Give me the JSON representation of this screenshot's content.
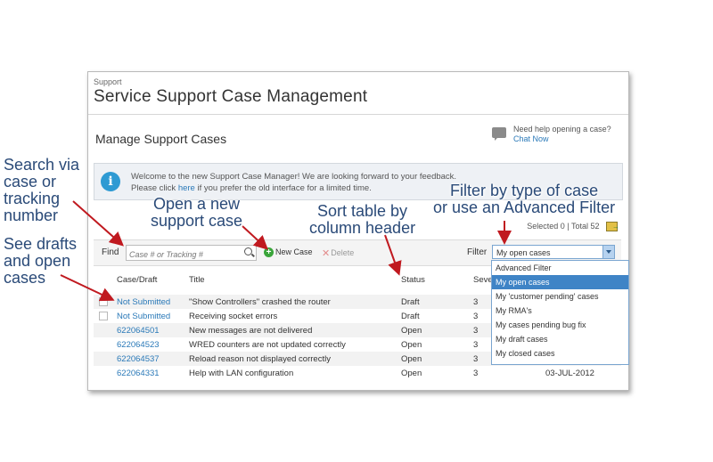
{
  "app": {
    "crumb": "Support",
    "title": "Service Support Case Management"
  },
  "page": {
    "heading": "Manage Support Cases"
  },
  "help": {
    "question": "Need help opening a case?",
    "link": "Chat Now",
    "icon": "chat-bubble-icon"
  },
  "welcome": {
    "icon": "info-icon",
    "line1": "Welcome to the new Support Case Manager! We are looking forward to your feedback.",
    "line2_before": "Please click ",
    "line2_link": "here",
    "line2_after": " if you prefer the old interface for a limited time."
  },
  "selection": {
    "text": "Selected 0  |  Total 52",
    "icon": "export-icon"
  },
  "toolbar": {
    "find_label": "Find",
    "search_placeholder": "Case # or Tracking #",
    "new_case": "New Case",
    "delete": "Delete",
    "filter_label": "Filter",
    "filter_value": "My open cases"
  },
  "table": {
    "headers": {
      "case": "Case/Draft",
      "title": "Title",
      "status": "Status",
      "severity": "Seve"
    },
    "rows": [
      {
        "case": "Not Submitted",
        "title": "\"Show Controllers\" crashed the router",
        "status": "Draft",
        "severity": "3",
        "date": "",
        "checkbox": true
      },
      {
        "case": "Not Submitted",
        "title": "Receiving socket errors",
        "status": "Draft",
        "severity": "3",
        "date": "",
        "checkbox": true
      },
      {
        "case": "622064501",
        "title": "New messages are not delivered",
        "status": "Open",
        "severity": "3",
        "date": "",
        "checkbox": false
      },
      {
        "case": "622064523",
        "title": "WRED counters are not updated correctly",
        "status": "Open",
        "severity": "3",
        "date": "",
        "checkbox": false
      },
      {
        "case": "622064537",
        "title": "Reload reason not displayed correctly",
        "status": "Open",
        "severity": "3",
        "date": "",
        "checkbox": false
      },
      {
        "case": "622064331",
        "title": "Help with LAN configuration",
        "status": "Open",
        "severity": "3",
        "date": "03-JUL-2012",
        "checkbox": false
      }
    ]
  },
  "filter_options": [
    "Advanced Filter",
    "My open cases",
    "My 'customer pending' cases",
    "My RMA's",
    "My cases pending bug fix",
    "My draft cases",
    "My closed cases"
  ],
  "annotations": {
    "search": "Search via\ncase or\ntracking\nnumber",
    "drafts": "See drafts\nand open\ncases",
    "newcase": "Open a new\nsupport case",
    "sort": "Sort table by\ncolumn header",
    "filter": "Filter by type of case\nor use an Advanced Filter"
  },
  "colors": {
    "link": "#2a79b8",
    "annotation": "#2a4a78",
    "arrow": "#c0191f",
    "highlight": "#3f84c6"
  }
}
